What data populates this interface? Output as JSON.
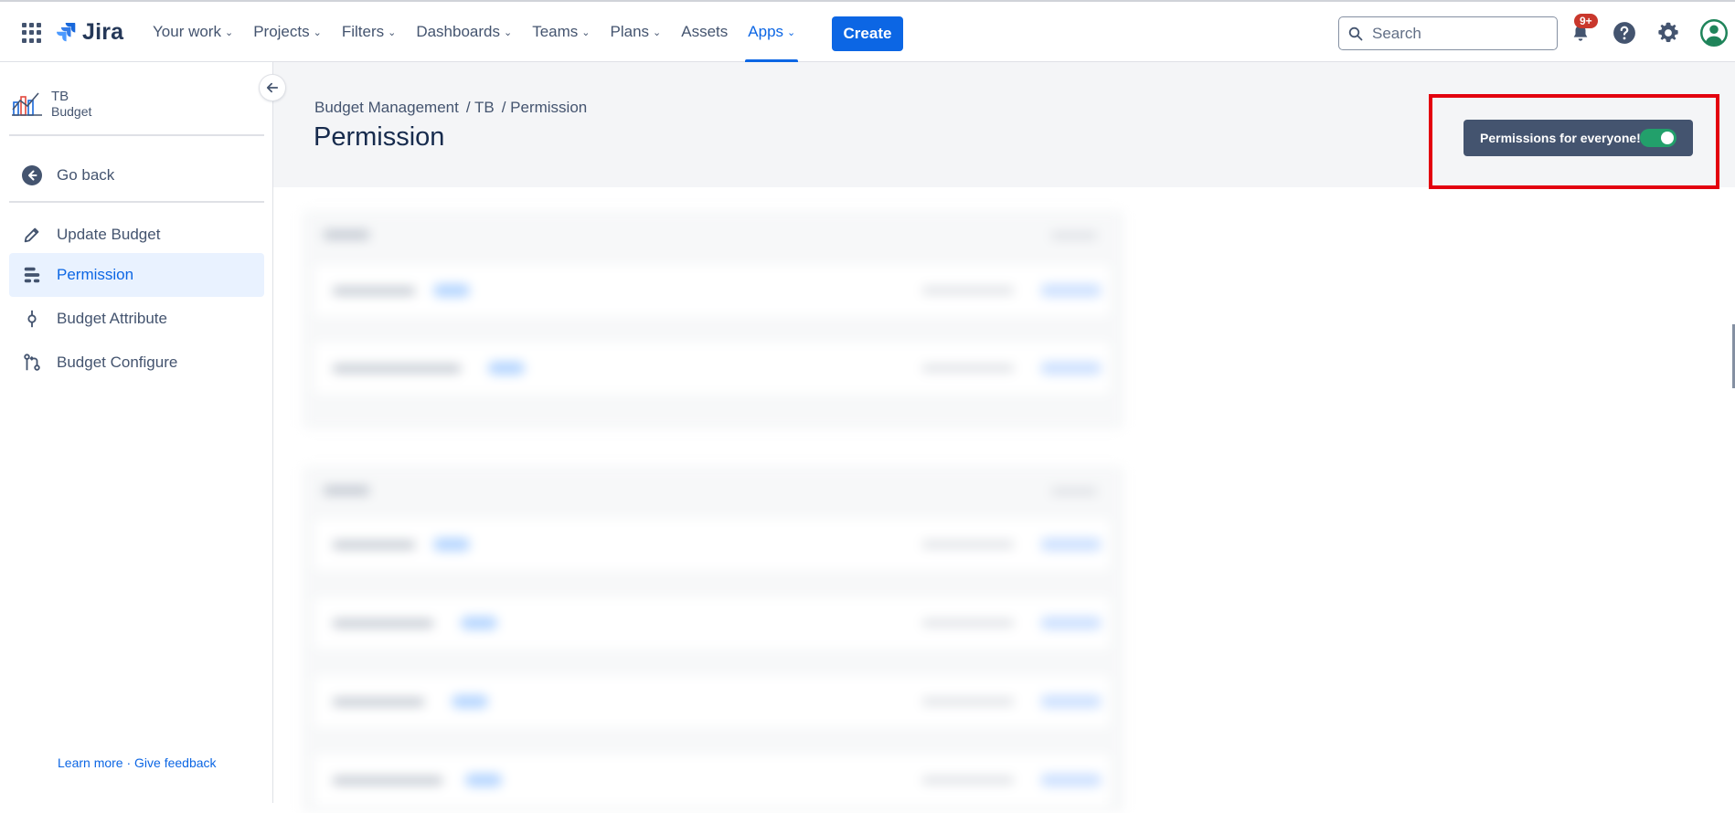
{
  "topnav": {
    "logo_text": "Jira",
    "items": [
      {
        "label": "Your work",
        "chevron": true
      },
      {
        "label": "Projects",
        "chevron": true
      },
      {
        "label": "Filters",
        "chevron": true
      },
      {
        "label": "Dashboards",
        "chevron": true
      },
      {
        "label": "Teams",
        "chevron": true
      },
      {
        "label": "Plans",
        "chevron": true
      },
      {
        "label": "Assets",
        "chevron": false
      },
      {
        "label": "Apps",
        "chevron": true
      }
    ],
    "active_item": "Apps",
    "create_label": "Create",
    "search_placeholder": "Search",
    "notification_badge": "9+",
    "accent_color": "#0c66e4",
    "icons": [
      "app-switcher-icon",
      "notifications-icon",
      "help-icon",
      "settings-icon",
      "profile-icon"
    ]
  },
  "sidebar": {
    "project_name": "TB",
    "project_type": "Budget",
    "go_back_label": "Go back",
    "items": [
      {
        "label": "Update Budget",
        "icon": "pencil-icon",
        "selected": false
      },
      {
        "label": "Permission",
        "icon": "permission-icon",
        "selected": true
      },
      {
        "label": "Budget Attribute",
        "icon": "attribute-icon",
        "selected": false
      },
      {
        "label": "Budget Configure",
        "icon": "configure-icon",
        "selected": false
      }
    ],
    "footer_learn_more": "Learn more",
    "footer_separator": " · ",
    "footer_feedback": "Give feedback"
  },
  "main": {
    "breadcrumb": [
      "Budget Management",
      "/ TB",
      "/ Permission"
    ],
    "title": "Permission",
    "toggle_label": "Permissions for everyone!",
    "toggle_on": true,
    "toggle_color": "#22a06b",
    "highlight_color": "#e3000f"
  }
}
